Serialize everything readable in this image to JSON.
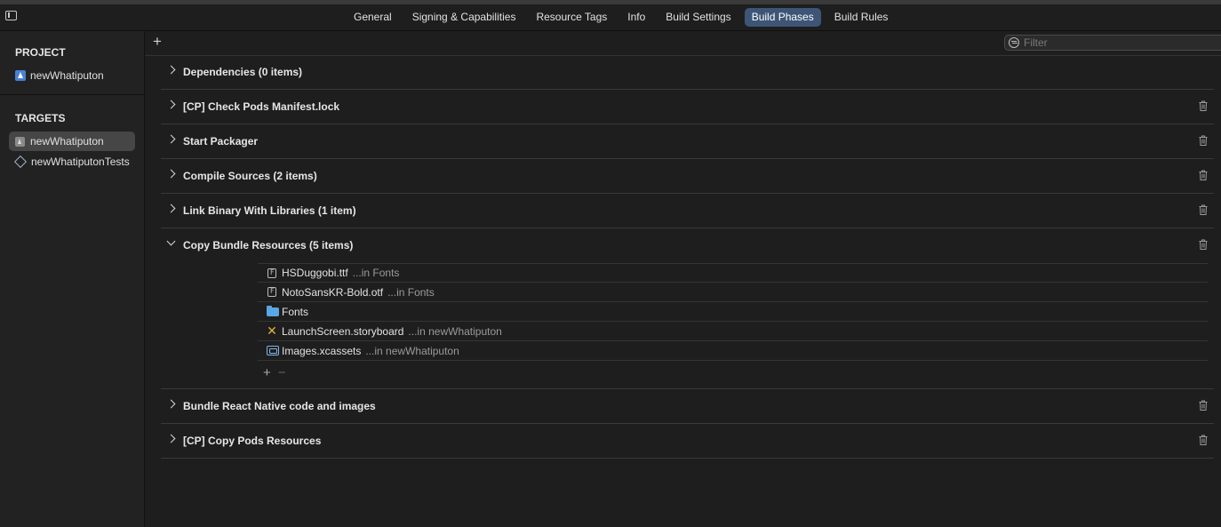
{
  "tabs": [
    {
      "label": "General"
    },
    {
      "label": "Signing & Capabilities"
    },
    {
      "label": "Resource Tags"
    },
    {
      "label": "Info"
    },
    {
      "label": "Build Settings"
    },
    {
      "label": "Build Phases",
      "active": true
    },
    {
      "label": "Build Rules"
    }
  ],
  "sidebar": {
    "project_title": "PROJECT",
    "project_item": "newWhatiputon",
    "targets_title": "TARGETS",
    "targets": [
      {
        "label": "newWhatiputon",
        "icon": "app-target-icon",
        "selected": true
      },
      {
        "label": "newWhatiputonTests",
        "icon": "test-target-icon"
      }
    ]
  },
  "toolbar": {
    "add": "+",
    "filter_placeholder": "Filter",
    "filter_value": ""
  },
  "phases": [
    {
      "title": "Dependencies (0 items)",
      "expanded": false,
      "deletable": false
    },
    {
      "title": "[CP] Check Pods Manifest.lock",
      "expanded": false,
      "deletable": true
    },
    {
      "title": "Start Packager",
      "expanded": false,
      "deletable": true
    },
    {
      "title": "Compile Sources (2 items)",
      "expanded": false,
      "deletable": true
    },
    {
      "title": "Link Binary With Libraries (1 item)",
      "expanded": false,
      "deletable": true
    },
    {
      "title": "Copy Bundle Resources (5 items)",
      "expanded": true,
      "deletable": true
    },
    {
      "title": "Bundle React Native code and images",
      "expanded": false,
      "deletable": true
    },
    {
      "title": "[CP] Copy Pods Resources",
      "expanded": false,
      "deletable": true
    }
  ],
  "bundle_files": [
    {
      "name": "HSDuggobi.ttf",
      "location": "...in Fonts",
      "icon": "font-file-icon"
    },
    {
      "name": "NotoSansKR-Bold.otf",
      "location": "...in Fonts",
      "icon": "font-file-icon"
    },
    {
      "name": "Fonts",
      "location": "",
      "icon": "folder-icon"
    },
    {
      "name": "LaunchScreen.storyboard",
      "location": "...in newWhatiputon",
      "icon": "storyboard-icon"
    },
    {
      "name": "Images.xcassets",
      "location": "...in newWhatiputon",
      "icon": "asset-catalog-icon"
    }
  ],
  "file_controls": {
    "add": "+",
    "remove": "−"
  }
}
